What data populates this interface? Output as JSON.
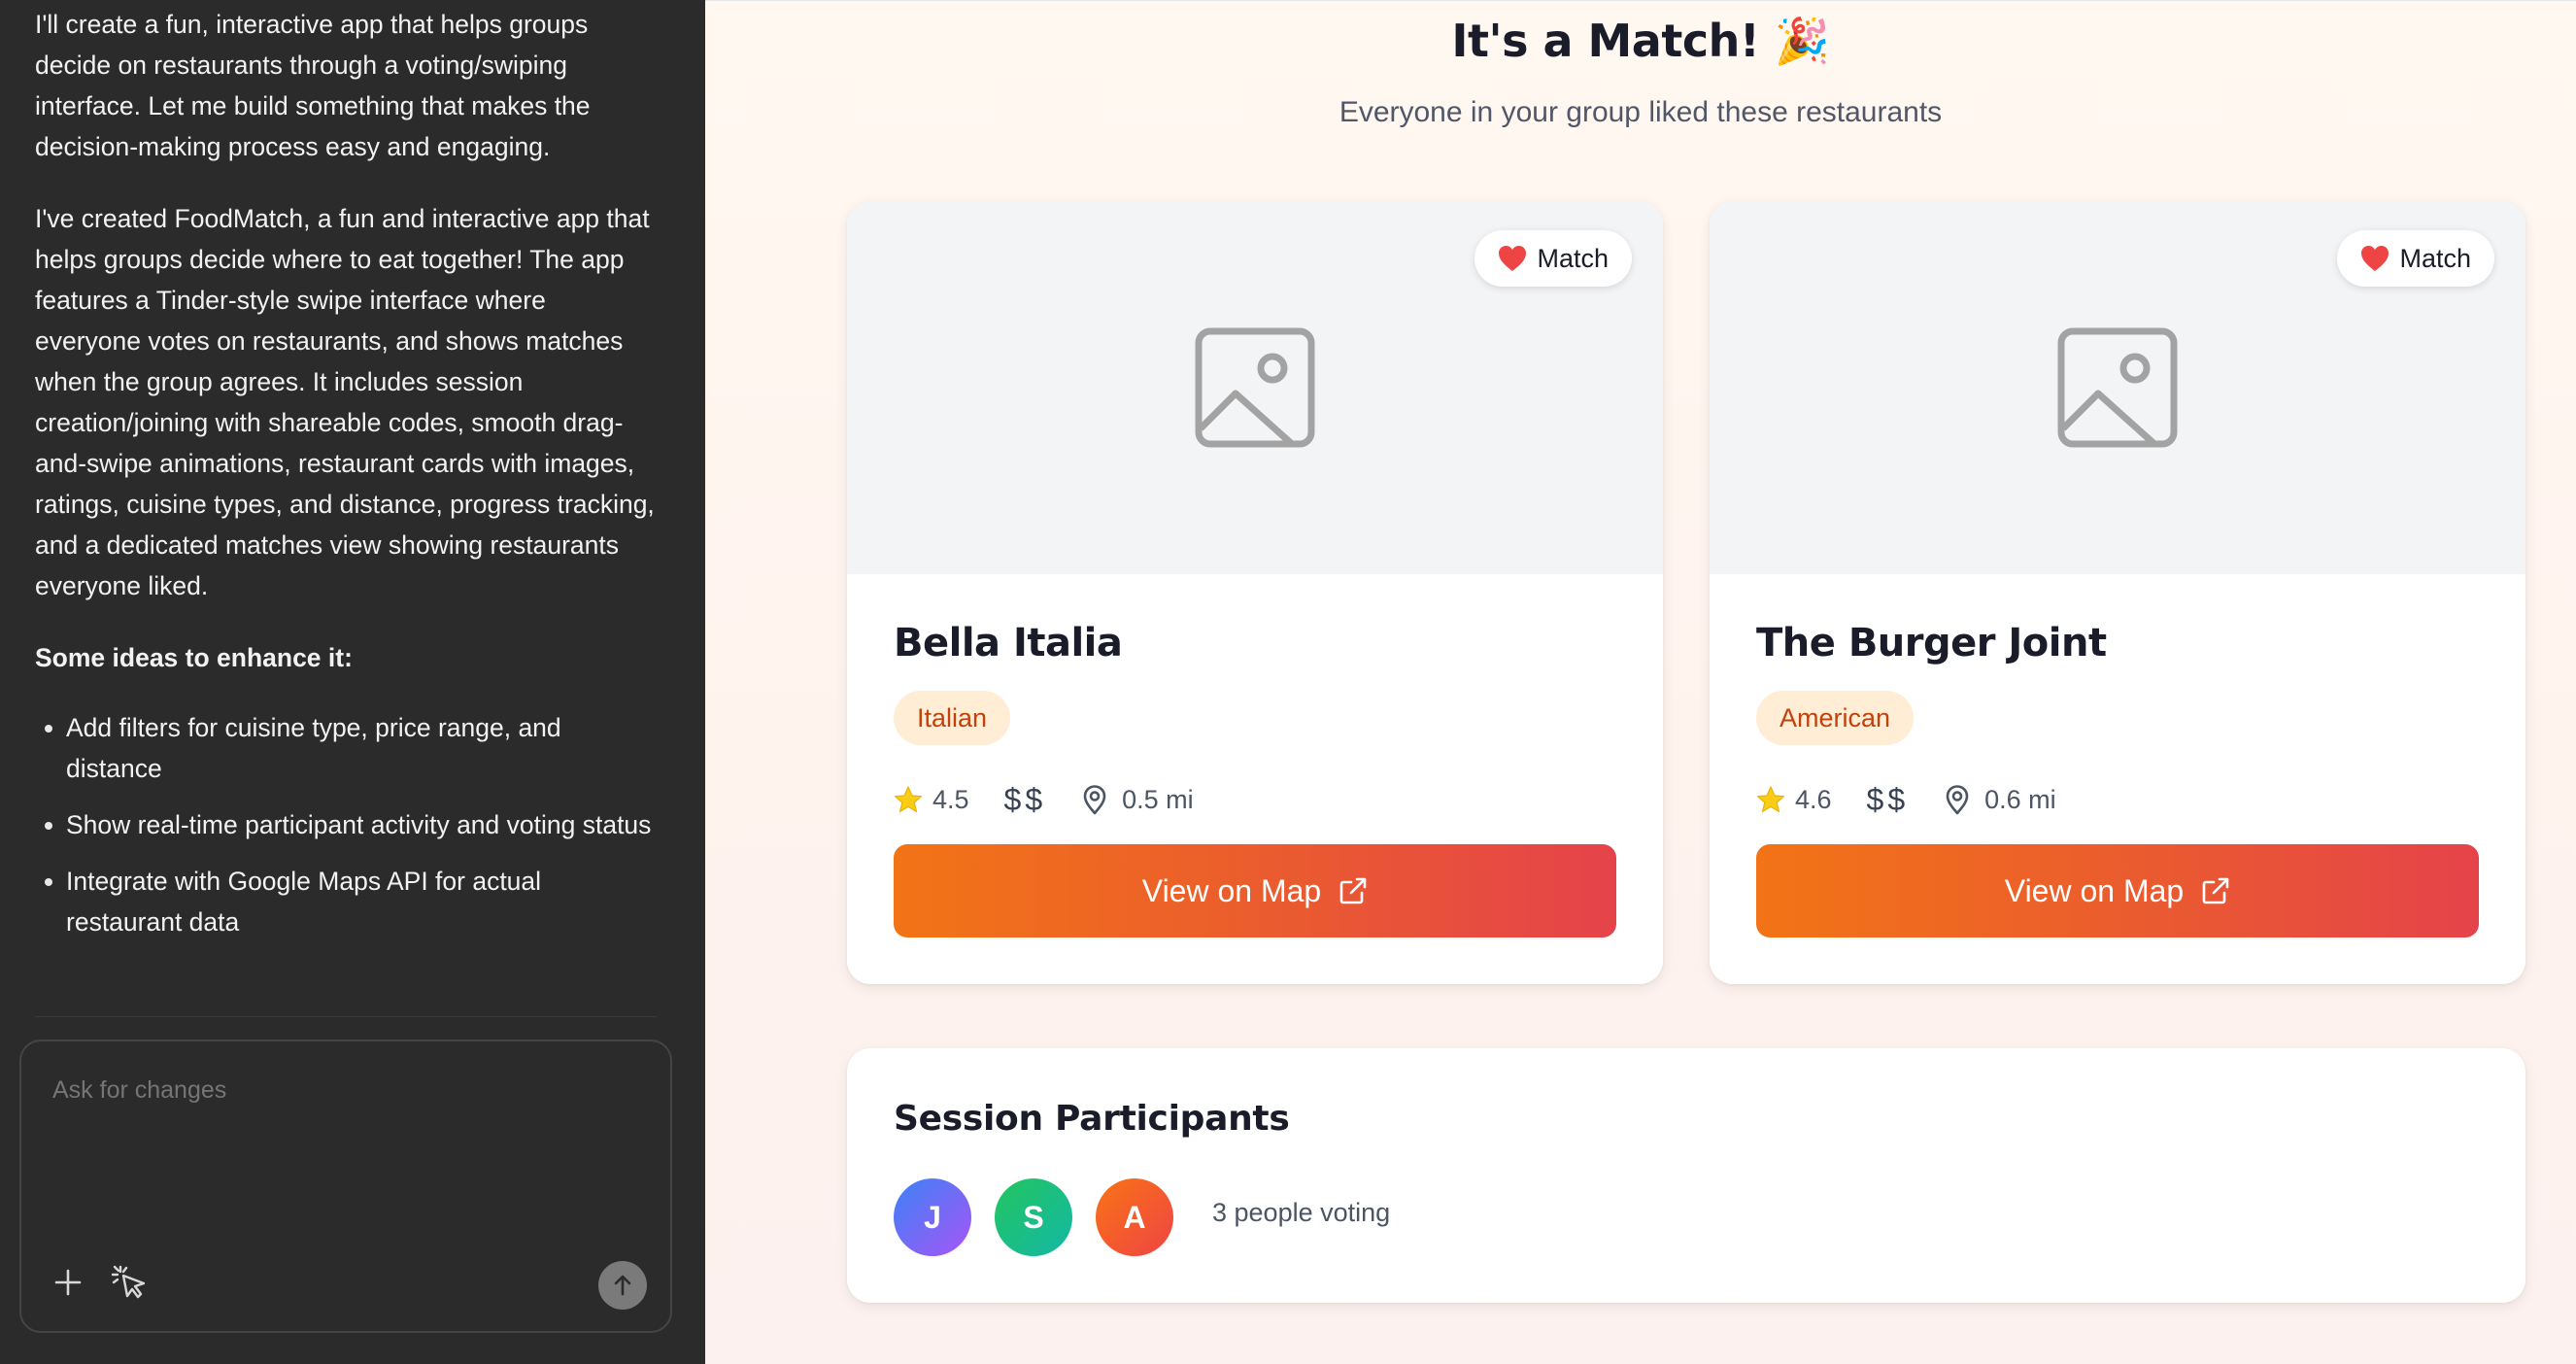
{
  "chat": {
    "paragraph_1": "I'll create a fun, interactive app that helps groups decide on restaurants through a voting/swiping interface. Let me build something that makes the decision-making process easy and engaging.",
    "paragraph_2": "I've created FoodMatch, a fun and interactive app that helps groups decide where to eat together! The app features a Tinder-style swipe interface where everyone votes on restaurants, and shows matches when the group agrees. It includes session creation/joining with shareable codes, smooth drag-and-swipe animations, restaurant cards with images, ratings, cuisine types, and distance, progress tracking, and a dedicated matches view showing restaurants everyone liked.",
    "ideas_heading": "Some ideas to enhance it:",
    "ideas": [
      "Add filters for cuisine type, price range, and distance",
      "Show real-time participant activity and voting status",
      "Integrate with Google Maps API for actual restaurant data"
    ],
    "composer_placeholder": "Ask for changes",
    "icons": [
      "plus-icon",
      "select-cursor-icon",
      "arrow-up-icon"
    ]
  },
  "main": {
    "title": "It's a Match! 🎉",
    "subtitle": "Everyone in your group liked these restaurants",
    "restaurants": [
      {
        "badge": "Match",
        "name": "Bella Italia",
        "cuisine": "Italian",
        "rating": "4.5",
        "price": "$$",
        "distance": "0.5 mi",
        "button_label": "View on Map"
      },
      {
        "badge": "Match",
        "name": "The Burger Joint",
        "cuisine": "American",
        "rating": "4.6",
        "price": "$$",
        "distance": "0.6 mi",
        "button_label": "View on Map"
      }
    ],
    "participants": {
      "title": "Session Participants",
      "avatars": [
        "J",
        "S",
        "A"
      ],
      "count_text": "3 people voting"
    }
  },
  "colors": {
    "accent_start": "#f27416",
    "accent_end": "#e5434a",
    "heart": "#ef4444",
    "star": "#facc15",
    "tag_bg": "#ffedd5",
    "tag_text": "#c2410c"
  }
}
